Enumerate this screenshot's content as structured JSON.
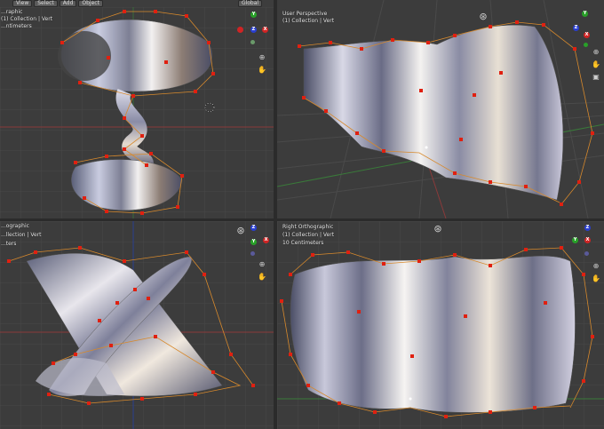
{
  "header": {
    "menus": [
      "View",
      "Select",
      "Add",
      "Object"
    ],
    "orientation": "Global"
  },
  "viewports": {
    "top_left": {
      "title": "...raphic",
      "collection": "(1) Collection | Vert",
      "scale": "...ntimeters"
    },
    "top_right": {
      "title": "User Perspective",
      "collection": "(1) Collection | Vert"
    },
    "bottom_left": {
      "title": "...ographic",
      "collection": "...llection | Vert",
      "scale": "...ters"
    },
    "bottom_right": {
      "title": "Right Orthographic",
      "collection": "(1) Collection | Vert",
      "scale": "10 Centimeters"
    }
  },
  "gizmo": {
    "z": "Z",
    "y": "Y",
    "x": "X"
  },
  "colors": {
    "x_axis": "#d02424",
    "y_axis": "#28a028",
    "z_axis": "#2a3fcf",
    "vertex": "#e02010",
    "edge": "#d7892c",
    "grid": "#4a4a4a"
  }
}
